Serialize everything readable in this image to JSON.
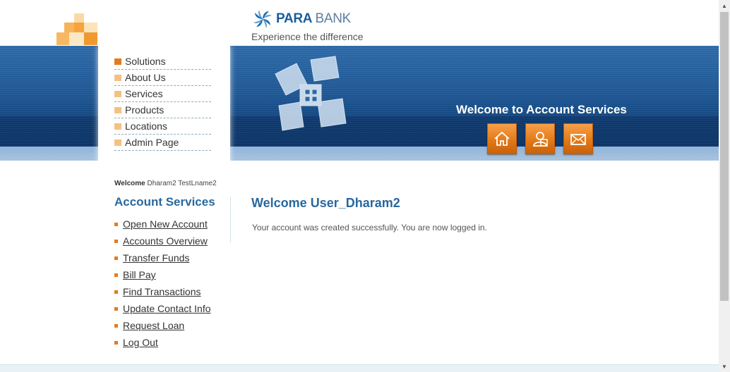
{
  "brand": {
    "name_part1": "PARA",
    "name_part2": "BANK",
    "tagline": "Experience the difference"
  },
  "header": {
    "welcome_title": "Welcome to Account Services"
  },
  "header_buttons": [
    {
      "icon": "home-icon"
    },
    {
      "icon": "about-icon"
    },
    {
      "icon": "contact-icon"
    }
  ],
  "menu": {
    "items": [
      {
        "label": "Solutions"
      },
      {
        "label": "About Us"
      },
      {
        "label": "Services"
      },
      {
        "label": "Products"
      },
      {
        "label": "Locations"
      },
      {
        "label": "Admin Page"
      }
    ]
  },
  "sidebar": {
    "welcome_label": "Welcome",
    "user_name": "Dharam2 TestLname2",
    "heading": "Account Services",
    "links": [
      {
        "label": "Open New Account"
      },
      {
        "label": "Accounts Overview"
      },
      {
        "label": "Transfer Funds"
      },
      {
        "label": "Bill Pay"
      },
      {
        "label": "Find Transactions"
      },
      {
        "label": "Update Contact Info"
      },
      {
        "label": "Request Loan"
      },
      {
        "label": "Log Out"
      }
    ]
  },
  "main": {
    "title": "Welcome User_Dharam2",
    "message": "Your account was created successfully. You are now logged in."
  },
  "colors": {
    "accent_orange": "#e37b1c",
    "brand_blue": "#28689e",
    "header_blue": "#1f5895"
  }
}
